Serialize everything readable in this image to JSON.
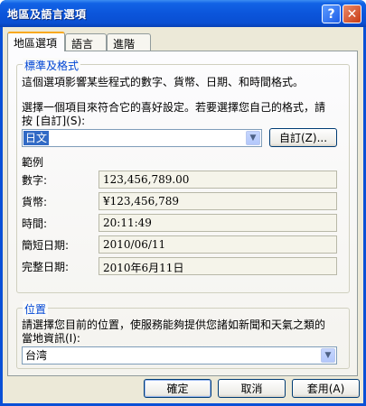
{
  "window": {
    "title": "地區及語言選項"
  },
  "tabs": [
    {
      "label": "地區選項",
      "active": true
    },
    {
      "label": "語言",
      "active": false
    },
    {
      "label": "進階",
      "active": false
    }
  ],
  "standards": {
    "legend": "標準及格式",
    "description": "這個選項影響某些程式的數字、貨幣、日期、和時間格式。",
    "instruction_line1": "選擇一個項目來符合它的喜好設定。若要選擇您自己的格式，請",
    "instruction_line2": "按 [自訂](S):",
    "locale_value": "日文",
    "customize_label": "自訂(Z)...",
    "examples_title": "範例",
    "examples": [
      {
        "label": "數字:",
        "value": "123,456,789.00"
      },
      {
        "label": "貨幣:",
        "value": "¥123,456,789"
      },
      {
        "label": "時間:",
        "value": "20:11:49"
      },
      {
        "label": "簡短日期:",
        "value": "2010/06/11"
      },
      {
        "label": "完整日期:",
        "value": "2010年6月11日"
      }
    ]
  },
  "location": {
    "legend": "位置",
    "description_line1": "請選擇您目前的位置，使服務能夠提供您諸如新聞和天氣之類的",
    "description_line2": "當地資訊(I):",
    "value": "台湾"
  },
  "footer": {
    "ok_label": "確定",
    "cancel_label": "取消",
    "apply_label": "套用(A)"
  },
  "colors": {
    "titlebar": "#0a4fd2",
    "dialog_bg": "#ece9d8",
    "group_legend": "#0046d5",
    "selection": "#316ac5"
  },
  "icons": {
    "help": "help-icon",
    "close": "close-icon",
    "dropdown": "chevron-down-icon"
  }
}
